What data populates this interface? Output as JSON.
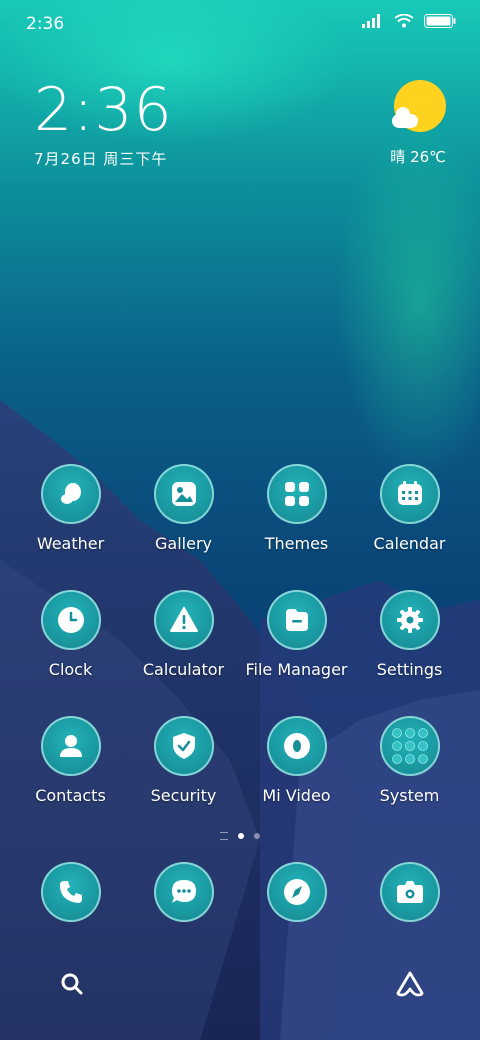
{
  "status": {
    "time": "2:36"
  },
  "clock": {
    "time": "2:36",
    "date": "7月26日 周三下午"
  },
  "weather": {
    "text": "晴 26℃"
  },
  "apps": [
    {
      "label": "Weather",
      "icon": "weather-icon"
    },
    {
      "label": "Gallery",
      "icon": "gallery-icon"
    },
    {
      "label": "Themes",
      "icon": "themes-icon"
    },
    {
      "label": "Calendar",
      "icon": "calendar-icon"
    },
    {
      "label": "Clock",
      "icon": "clock-icon"
    },
    {
      "label": "Calculator",
      "icon": "warning-icon"
    },
    {
      "label": "File Manager",
      "icon": "folder-icon"
    },
    {
      "label": "Settings",
      "icon": "gear-icon"
    },
    {
      "label": "Contacts",
      "icon": "contacts-icon"
    },
    {
      "label": "Security",
      "icon": "shield-icon"
    },
    {
      "label": "Mi Video",
      "icon": "video-icon"
    },
    {
      "label": "System",
      "icon": "folder-grid-icon"
    }
  ],
  "dock": [
    "phone-icon",
    "messages-icon",
    "browser-icon",
    "camera-icon"
  ],
  "colors": {
    "icon_bg": "#16919a",
    "sun": "#ffd21f"
  }
}
